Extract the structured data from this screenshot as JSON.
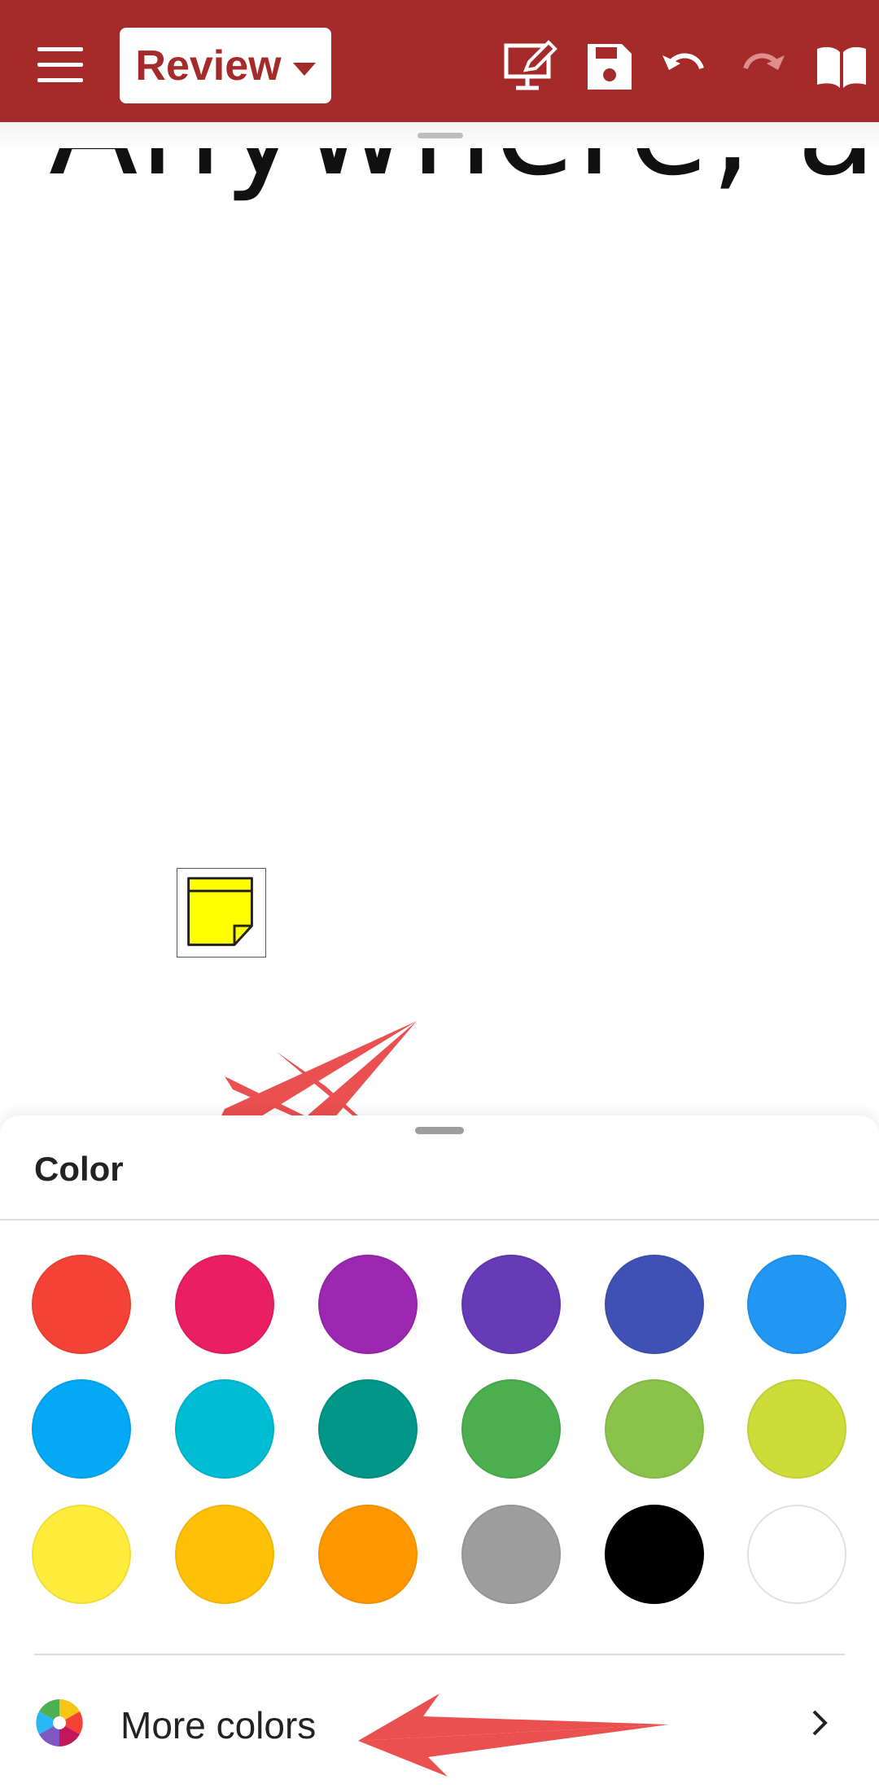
{
  "toolbar": {
    "menu_icon": "hamburger-menu-icon",
    "mode_label": "Review",
    "icons": [
      "present-edit-icon",
      "save-icon",
      "undo-icon",
      "redo-icon",
      "read-mode-icon"
    ],
    "background_color": "#a52a2a"
  },
  "document": {
    "visible_text": "Anywhere, a"
  },
  "color_sheet": {
    "title": "Color",
    "swatches": [
      {
        "name": "red",
        "color": "#f44336"
      },
      {
        "name": "pink",
        "color": "#e91e63"
      },
      {
        "name": "purple",
        "color": "#9c27b0"
      },
      {
        "name": "deep-purple",
        "color": "#673ab7"
      },
      {
        "name": "indigo",
        "color": "#3f51b5"
      },
      {
        "name": "blue",
        "color": "#2196f3"
      },
      {
        "name": "light-blue",
        "color": "#03a9f4"
      },
      {
        "name": "cyan",
        "color": "#00bcd4"
      },
      {
        "name": "teal",
        "color": "#009688"
      },
      {
        "name": "green",
        "color": "#4caf50"
      },
      {
        "name": "light-green",
        "color": "#8bc34a"
      },
      {
        "name": "lime",
        "color": "#cddc39"
      },
      {
        "name": "yellow",
        "color": "#ffeb3b"
      },
      {
        "name": "amber",
        "color": "#ffc107"
      },
      {
        "name": "orange",
        "color": "#ff9800"
      },
      {
        "name": "grey",
        "color": "#9e9e9e"
      },
      {
        "name": "black",
        "color": "#000000"
      },
      {
        "name": "white",
        "color": "#ffffff"
      }
    ],
    "more_colors_label": "More colors"
  }
}
